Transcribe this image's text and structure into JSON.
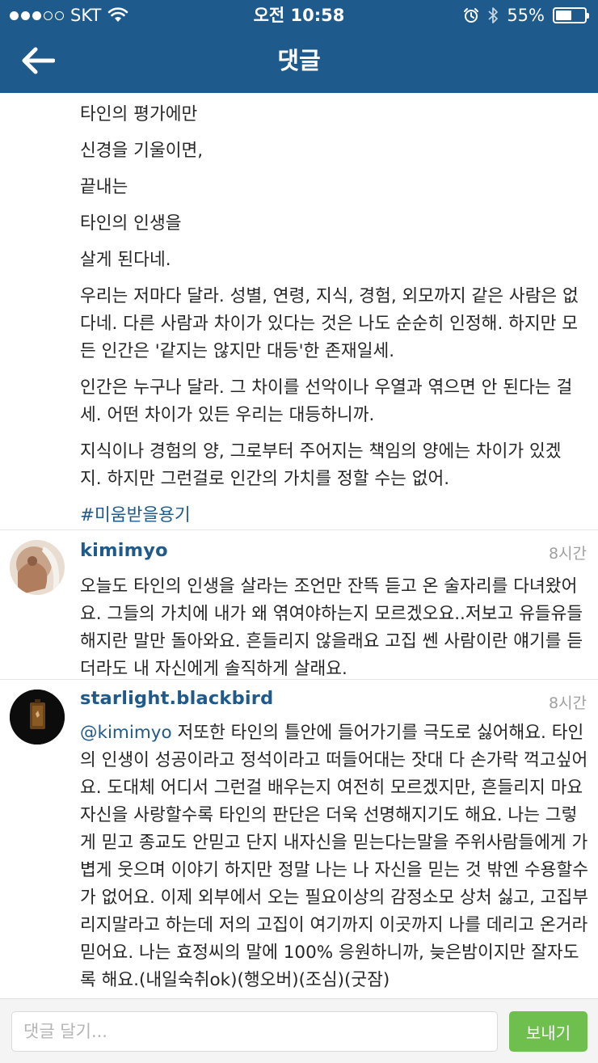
{
  "status_bar": {
    "carrier": "SKT",
    "time": "오전 10:58",
    "battery_percent": "55%",
    "battery_level": 0.55
  },
  "nav": {
    "title": "댓글",
    "back_icon": "arrow-left-icon"
  },
  "caption": {
    "lines": [
      "타인의 평가에만",
      "신경을 기울이면,",
      "끝내는",
      "타인의 인생을",
      "살게 된다네."
    ],
    "paragraphs": [
      "우리는 저마다 달라. 성별, 연령, 지식, 경험, 외모까지 같은 사람은 없다네. 다른 사람과 차이가 있다는 것은 나도 순순히 인정해. 하지만 모든 인간은 '같지는 않지만 대등'한 존재일세.",
      "인간은 누구나 달라. 그 차이를 선악이나 우열과 엮으면 안 된다는 걸세. 어떤 차이가 있든 우리는 대등하니까.",
      "지식이나 경험의 양, 그로부터 주어지는 책임의 양에는 차이가 있겠지. 하지만 그런걸로 인간의 가치를 정할 수는 없어."
    ],
    "hashtag": "#미움받을용기"
  },
  "comments": [
    {
      "username": "kimimyo",
      "time": "8시간",
      "mention": "",
      "text": "오늘도 타인의 인생을 살라는 조언만 잔뜩 듣고 온 술자리를 다녀왔어요. 그들의 가치에 내가 왜 엮여야하는지 모르겠오요..저보고 유들유들해지란 말만 돌아와요. 흔들리지 않을래요 고집 쎈 사람이란 얘기를 듣더라도 내 자신에게 솔직하게 살래요."
    },
    {
      "username": "starlight.blackbird",
      "time": "8시간",
      "mention": "@kimimyo",
      "text": " 저또한 타인의 틀안에 들어가기를 극도로 싫어해요. 타인의 인생이 성공이라고 정석이라고 떠들어대는 잣대 다 손가락 꺽고싶어요. 도대체 어디서 그런걸 배우는지 여전히 모르겠지만, 흔들리지 마요 자신을 사랑할수록 타인의 판단은 더욱 선명해지기도 해요. 나는 그렇게 믿고 종교도 안믿고 단지 내자신을 믿는다는말을 주위사람들에게 가볍게 웃으며 이야기 하지만 정말 나는 나 자신을 믿는 것 밖엔 수용할수가 없어요. 이제 외부에서 오는 필요이상의 감정소모 상처 싫고, 고집부리지말라고 하는데 저의 고집이 여기까지 이곳까지 나를 데리고 온거라 믿어요. 나는 효정씨의 말에 100% 응원하니까, 늦은밤이지만 잘자도록 해요.(내일숙취ok)(행오버)(조심)(굿잠)"
    }
  ],
  "input": {
    "placeholder": "댓글 달기...",
    "send_label": "보내기"
  },
  "colors": {
    "brand": "#1e5a8c",
    "send_button": "#6fbf4f"
  }
}
